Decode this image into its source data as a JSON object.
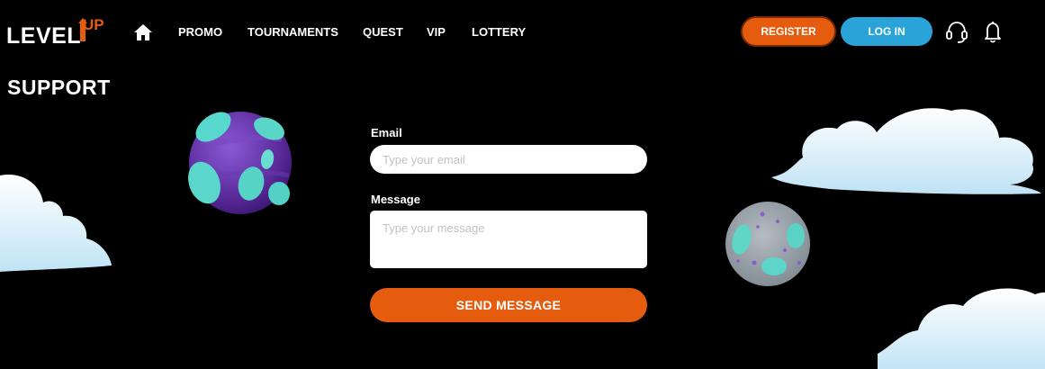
{
  "header": {
    "logo": {
      "main": "LEVEL",
      "accent": "UP"
    },
    "nav": [
      {
        "label": "PROMO"
      },
      {
        "label": "TOURNAMENTS"
      },
      {
        "label": "QUEST"
      },
      {
        "label": "VIP"
      },
      {
        "label": "LOTTERY"
      }
    ],
    "register_label": "REGISTER",
    "login_label": "LOG IN"
  },
  "page": {
    "title": "SUPPORT"
  },
  "form": {
    "email_label": "Email",
    "email_placeholder": "Type your email",
    "email_value": "",
    "message_label": "Message",
    "message_placeholder": "Type your message",
    "message_value": "",
    "send_label": "SEND MESSAGE"
  },
  "icons": {
    "home": "home-icon",
    "support": "headset-icon",
    "notifications": "bell-icon"
  },
  "colors": {
    "accent": "#e55c0f",
    "login": "#2aa3d8",
    "background": "#000000"
  }
}
